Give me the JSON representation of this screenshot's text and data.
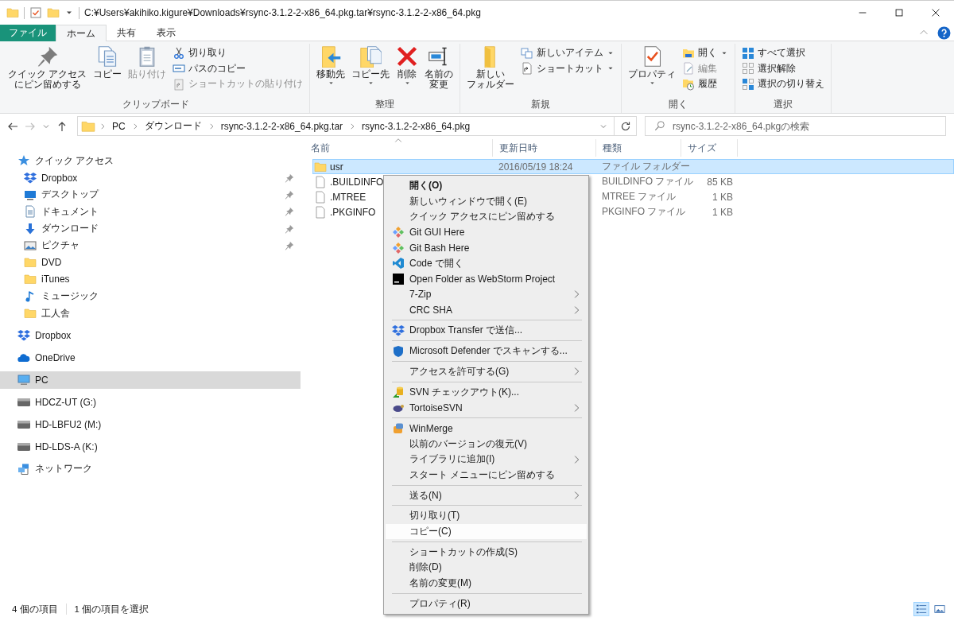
{
  "window": {
    "title": "C:¥Users¥akihiko.kigure¥Downloads¥rsync-3.1.2-2-x86_64.pkg.tar¥rsync-3.1.2-2-x86_64.pkg"
  },
  "ribbon": {
    "tabs": [
      {
        "label": "ファイル",
        "kind": "file",
        "selected": false
      },
      {
        "label": "ホーム",
        "kind": "tab",
        "selected": true
      },
      {
        "label": "共有",
        "kind": "tab",
        "selected": false
      },
      {
        "label": "表示",
        "kind": "tab",
        "selected": false
      }
    ],
    "groups": [
      {
        "label": "クリップボード",
        "large": [
          {
            "kind": "pin",
            "lines": [
              "クイック アクセス",
              "にピン留めする"
            ],
            "disabled": false,
            "dropdown": false
          },
          {
            "kind": "copy",
            "lines": [
              "コピー"
            ],
            "disabled": false,
            "dropdown": false
          },
          {
            "kind": "paste",
            "lines": [
              "貼り付け"
            ],
            "disabled": true,
            "dropdown": false
          }
        ],
        "small": [
          {
            "kind": "scissors",
            "label": "切り取り",
            "disabled": false,
            "dropdown": false
          },
          {
            "kind": "pathcopy",
            "label": "パスのコピー",
            "disabled": false,
            "dropdown": false
          },
          {
            "kind": "shortcutpaste",
            "label": "ショートカットの貼り付け",
            "disabled": true,
            "dropdown": false
          }
        ]
      },
      {
        "label": "整理",
        "large": [
          {
            "kind": "moveto",
            "lines": [
              "移動先"
            ],
            "disabled": false,
            "dropdown": true
          },
          {
            "kind": "copyto",
            "lines": [
              "コピー先"
            ],
            "disabled": false,
            "dropdown": true
          },
          {
            "kind": "delete",
            "lines": [
              "削除"
            ],
            "disabled": false,
            "dropdown": true
          },
          {
            "kind": "rename",
            "lines": [
              "名前の",
              "変更"
            ],
            "disabled": false,
            "dropdown": false
          }
        ]
      },
      {
        "label": "新規",
        "large": [
          {
            "kind": "newfolder",
            "lines": [
              "新しい",
              "フォルダー"
            ],
            "disabled": false,
            "dropdown": false
          }
        ],
        "small": [
          {
            "kind": "newitem",
            "label": "新しいアイテム",
            "disabled": false,
            "dropdown": true
          },
          {
            "kind": "shortcut",
            "label": "ショートカット",
            "disabled": false,
            "dropdown": true
          }
        ]
      },
      {
        "label": "開く",
        "large": [
          {
            "kind": "properties",
            "lines": [
              "プロパティ"
            ],
            "disabled": false,
            "dropdown": true
          }
        ],
        "small": [
          {
            "kind": "open",
            "label": "開く",
            "disabled": false,
            "dropdown": true
          },
          {
            "kind": "edit",
            "label": "編集",
            "disabled": true,
            "dropdown": false
          },
          {
            "kind": "history",
            "label": "履歴",
            "disabled": false,
            "dropdown": false
          }
        ]
      },
      {
        "label": "選択",
        "small": [
          {
            "kind": "selectall",
            "label": "すべて選択",
            "disabled": false,
            "dropdown": false
          },
          {
            "kind": "selectnone",
            "label": "選択解除",
            "disabled": false,
            "dropdown": false
          },
          {
            "kind": "invert",
            "label": "選択の切り替え",
            "disabled": false,
            "dropdown": false
          }
        ]
      }
    ]
  },
  "address": {
    "back_disabled": false,
    "forward_disabled": true,
    "crumbs": [
      "PC",
      "ダウンロード",
      "rsync-3.1.2-2-x86_64.pkg.tar",
      "rsync-3.1.2-2-x86_64.pkg"
    ],
    "search": {
      "placeholder": "rsync-3.1.2-2-x86_64.pkgの検索"
    }
  },
  "sidebar": {
    "items": [
      {
        "label": "クイック アクセス",
        "kind": "star",
        "selected": false,
        "children": [
          {
            "label": "Dropbox",
            "kind": "dropbox",
            "pinned": true,
            "selected": false
          },
          {
            "label": "デスクトップ",
            "kind": "desktop",
            "pinned": true,
            "selected": false
          },
          {
            "label": "ドキュメント",
            "kind": "doc",
            "pinned": true,
            "selected": false
          },
          {
            "label": "ダウンロード",
            "kind": "download",
            "pinned": true,
            "selected": false
          },
          {
            "label": "ピクチャ",
            "kind": "picture",
            "pinned": true,
            "selected": false
          },
          {
            "label": "DVD",
            "kind": "folder",
            "pinned": false,
            "selected": false
          },
          {
            "label": "iTunes",
            "kind": "folder",
            "pinned": false,
            "selected": false
          },
          {
            "label": "ミュージック",
            "kind": "music",
            "pinned": false,
            "selected": false
          },
          {
            "label": "工人舎",
            "kind": "folder",
            "pinned": false,
            "selected": false
          }
        ]
      },
      {
        "label": "Dropbox",
        "kind": "dropbox",
        "selected": false
      },
      {
        "label": "OneDrive",
        "kind": "onedrive",
        "selected": false
      },
      {
        "label": "PC",
        "kind": "pc",
        "selected": true
      },
      {
        "label": "HDCZ-UT (G:)",
        "kind": "drive",
        "selected": false
      },
      {
        "label": "HD-LBFU2 (M:)",
        "kind": "drive",
        "selected": false
      },
      {
        "label": "HD-LDS-A (K:)",
        "kind": "drive",
        "selected": false
      },
      {
        "label": "ネットワーク",
        "kind": "network",
        "selected": false
      }
    ]
  },
  "files": {
    "columns": [
      {
        "label": "名前",
        "sorted": true
      },
      {
        "label": "更新日時",
        "sorted": false
      },
      {
        "label": "種類",
        "sorted": false
      },
      {
        "label": "サイズ",
        "sorted": false
      }
    ],
    "rows": [
      {
        "kind": "folder",
        "name": "usr",
        "modified": "2016/05/19 18:24",
        "type": "ファイル フォルダー",
        "selected": true
      },
      {
        "kind": "file",
        "name": ".BUILDINFO",
        "type": "BUILDINFO ファイル",
        "size": "85 KB",
        "selected": false
      },
      {
        "kind": "file",
        "name": ".MTREE",
        "type": "MTREE ファイル",
        "size": "1 KB",
        "selected": false
      },
      {
        "kind": "file",
        "name": ".PKGINFO",
        "type": "PKGINFO ファイル",
        "size": "1 KB",
        "selected": false
      }
    ]
  },
  "context_menu": {
    "items": [
      {
        "kind": "plain",
        "label": "開く(O)",
        "default": true,
        "submenu": false,
        "selected": false
      },
      {
        "kind": "plain",
        "label": "新しいウィンドウで開く(E)",
        "default": false,
        "submenu": false,
        "selected": false
      },
      {
        "kind": "plain",
        "label": "クイック アクセスにピン留めする",
        "default": false,
        "submenu": false,
        "selected": false
      },
      {
        "kind": "git",
        "label": "Git GUI Here",
        "default": false,
        "submenu": false,
        "selected": false
      },
      {
        "kind": "git",
        "label": "Git Bash Here",
        "default": false,
        "submenu": false,
        "selected": false
      },
      {
        "kind": "vscode",
        "label": "Code で開く",
        "default": false,
        "submenu": false,
        "selected": false
      },
      {
        "kind": "webstorm",
        "label": "Open Folder as WebStorm Project",
        "default": false,
        "submenu": false,
        "selected": false
      },
      {
        "kind": "plain",
        "label": "7-Zip",
        "default": false,
        "submenu": true,
        "selected": false
      },
      {
        "kind": "plain",
        "label": "CRC SHA",
        "default": false,
        "submenu": true,
        "selected": false
      },
      {
        "kind": "separator"
      },
      {
        "kind": "dropbox",
        "label": "Dropbox Transfer で送信...",
        "default": false,
        "submenu": false,
        "selected": false
      },
      {
        "kind": "separator"
      },
      {
        "kind": "defender",
        "label": "Microsoft Defender でスキャンする...",
        "default": false,
        "submenu": false,
        "selected": false
      },
      {
        "kind": "separator"
      },
      {
        "kind": "plain",
        "label": "アクセスを許可する(G)",
        "default": false,
        "submenu": true,
        "selected": false
      },
      {
        "kind": "separator"
      },
      {
        "kind": "svn",
        "label": "SVN チェックアウト(K)...",
        "default": false,
        "submenu": false,
        "selected": false
      },
      {
        "kind": "tortoise",
        "label": "TortoiseSVN",
        "default": false,
        "submenu": true,
        "selected": false
      },
      {
        "kind": "separator"
      },
      {
        "kind": "winmerge",
        "label": "WinMerge",
        "default": false,
        "submenu": false,
        "selected": false
      },
      {
        "kind": "plain",
        "label": "以前のバージョンの復元(V)",
        "default": false,
        "submenu": false,
        "selected": false
      },
      {
        "kind": "plain",
        "label": "ライブラリに追加(I)",
        "default": false,
        "submenu": true,
        "selected": false
      },
      {
        "kind": "plain",
        "label": "スタート メニューにピン留めする",
        "default": false,
        "submenu": false,
        "selected": false
      },
      {
        "kind": "separator"
      },
      {
        "kind": "plain",
        "label": "送る(N)",
        "default": false,
        "submenu": true,
        "selected": false
      },
      {
        "kind": "separator"
      },
      {
        "kind": "plain",
        "label": "切り取り(T)",
        "default": false,
        "submenu": false,
        "selected": false
      },
      {
        "kind": "plain",
        "label": "コピー(C)",
        "default": false,
        "submenu": false,
        "selected": true
      },
      {
        "kind": "separator"
      },
      {
        "kind": "plain",
        "label": "ショートカットの作成(S)",
        "default": false,
        "submenu": false,
        "selected": false
      },
      {
        "kind": "plain",
        "label": "削除(D)",
        "default": false,
        "submenu": false,
        "selected": false
      },
      {
        "kind": "plain",
        "label": "名前の変更(M)",
        "default": false,
        "submenu": false,
        "selected": false
      },
      {
        "kind": "separator"
      },
      {
        "kind": "plain",
        "label": "プロパティ(R)",
        "default": false,
        "submenu": false,
        "selected": false
      }
    ]
  },
  "status_bar": {
    "texts": [
      "4 個の項目",
      "1 個の項目を選択"
    ],
    "views": [
      {
        "kind": "details",
        "selected": true
      },
      {
        "kind": "thumbnails",
        "selected": false
      }
    ]
  }
}
